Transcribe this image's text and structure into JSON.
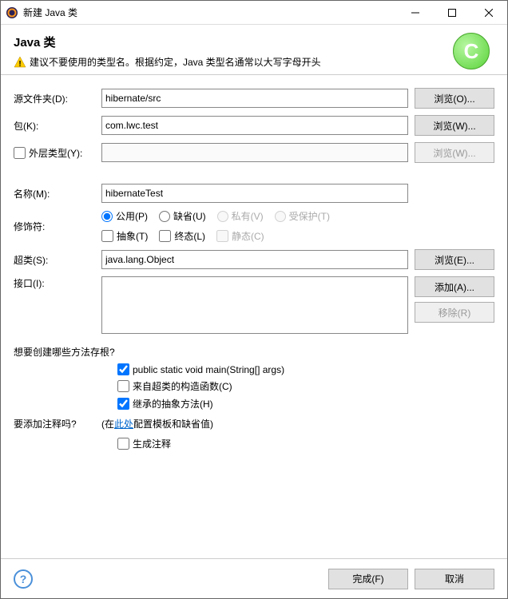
{
  "titlebar": {
    "title": "新建 Java 类"
  },
  "header": {
    "heading": "Java 类",
    "warning_text": "建议不要使用的类型名。根据约定，Java 类型名通常以大写字母开头"
  },
  "fields": {
    "source_folder_label": "源文件夹(D):",
    "source_folder_value": "hibernate/src",
    "source_folder_browse": "浏览(O)...",
    "package_label": "包(K):",
    "package_value": "com.lwc.test",
    "package_browse": "浏览(W)...",
    "enclosing_label": "外层类型(Y):",
    "enclosing_value": "",
    "enclosing_browse": "浏览(W)...",
    "name_label": "名称(M):",
    "name_value": "hibernateTest",
    "modifiers_label": "修饰符:",
    "mod_public": "公用(P)",
    "mod_default": "缺省(U)",
    "mod_private": "私有(V)",
    "mod_protected": "受保护(T)",
    "mod_abstract": "抽象(T)",
    "mod_final": "终态(L)",
    "mod_static": "静态(C)",
    "superclass_label": "超类(S):",
    "superclass_value": "java.lang.Object",
    "superclass_browse": "浏览(E)...",
    "interfaces_label": "接口(I):",
    "interfaces_add": "添加(A)...",
    "interfaces_remove": "移除(R)"
  },
  "stubs": {
    "question": "想要创建哪些方法存根?",
    "main": "public static void main(String[] args)",
    "ctor": "来自超类的构造函数(C)",
    "inherited": "继承的抽象方法(H)"
  },
  "comments": {
    "question_prefix": "要添加注释吗?",
    "config_prefix": "(在",
    "config_link": "此处",
    "config_suffix": "配置模板和缺省值)",
    "generate": "生成注释"
  },
  "footer": {
    "finish": "完成(F)",
    "cancel": "取消"
  }
}
